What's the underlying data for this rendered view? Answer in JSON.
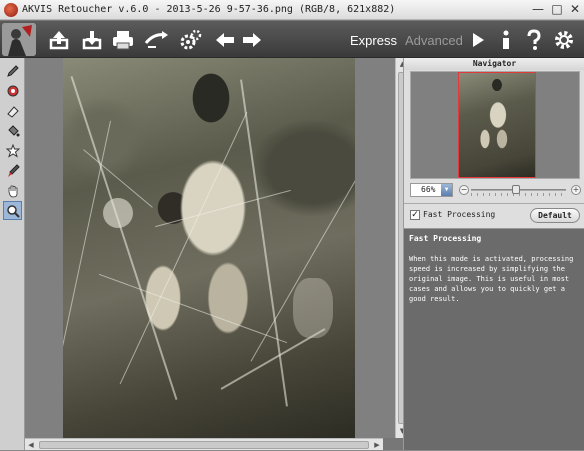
{
  "window": {
    "title": "AKVIS Retoucher v.6.0 - 2013-5-26 9-57-36.png (RGB/8, 621x882)",
    "min_glyph": "—",
    "max_glyph": "□",
    "close_glyph": "✕"
  },
  "toolbar": {
    "mode_express": "Express",
    "mode_advanced": "Advanced"
  },
  "navigator": {
    "title": "Navigator",
    "zoom_value": "66%",
    "zoom_fraction": 0.47,
    "minus_glyph": "−",
    "plus_glyph": "+"
  },
  "settings": {
    "fast_processing_checked": true,
    "check_glyph": "✓",
    "fast_processing_label": "Fast Processing",
    "default_label": "Default"
  },
  "help": {
    "title": "Fast Processing",
    "body": "When this mode is activated, processing speed is increased by simplifying the original image. This is useful in most cases and allows you to quickly get a good result."
  },
  "scroll": {
    "up_glyph": "▲",
    "down_glyph": "▼",
    "left_glyph": "◀",
    "right_glyph": "▶"
  },
  "colors": {
    "accent": "#5a7fae",
    "mode_active": "#ffffff",
    "mode_inactive": "#9a9a9a",
    "frame": "#e03a3a"
  }
}
